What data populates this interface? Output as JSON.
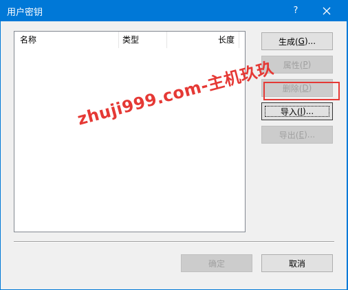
{
  "window": {
    "title": "用户密钥",
    "help_label": "?",
    "close_icon": "close-icon"
  },
  "list": {
    "columns": [
      "名称",
      "类型",
      "长度"
    ],
    "rows": []
  },
  "buttons": {
    "generate_label": "生成(",
    "generate_acc": "G",
    "generate_tail": ")...",
    "props_label": "属性(",
    "props_acc": "P",
    "props_tail": ")",
    "delete_label": "删除(",
    "delete_acc": "D",
    "delete_tail": ")",
    "import_label": "导入(",
    "import_acc": "I",
    "import_tail": ")...",
    "export_label": "导出(",
    "export_acc": "E",
    "export_tail": ")...",
    "ok_label": "确定",
    "cancel_label": "取消"
  },
  "watermark": "zhuji999.com-主机玖玖",
  "colors": {
    "titlebar": "#0078d7",
    "highlight": "#e53935",
    "dialog_bg": "#f0f0f0"
  }
}
